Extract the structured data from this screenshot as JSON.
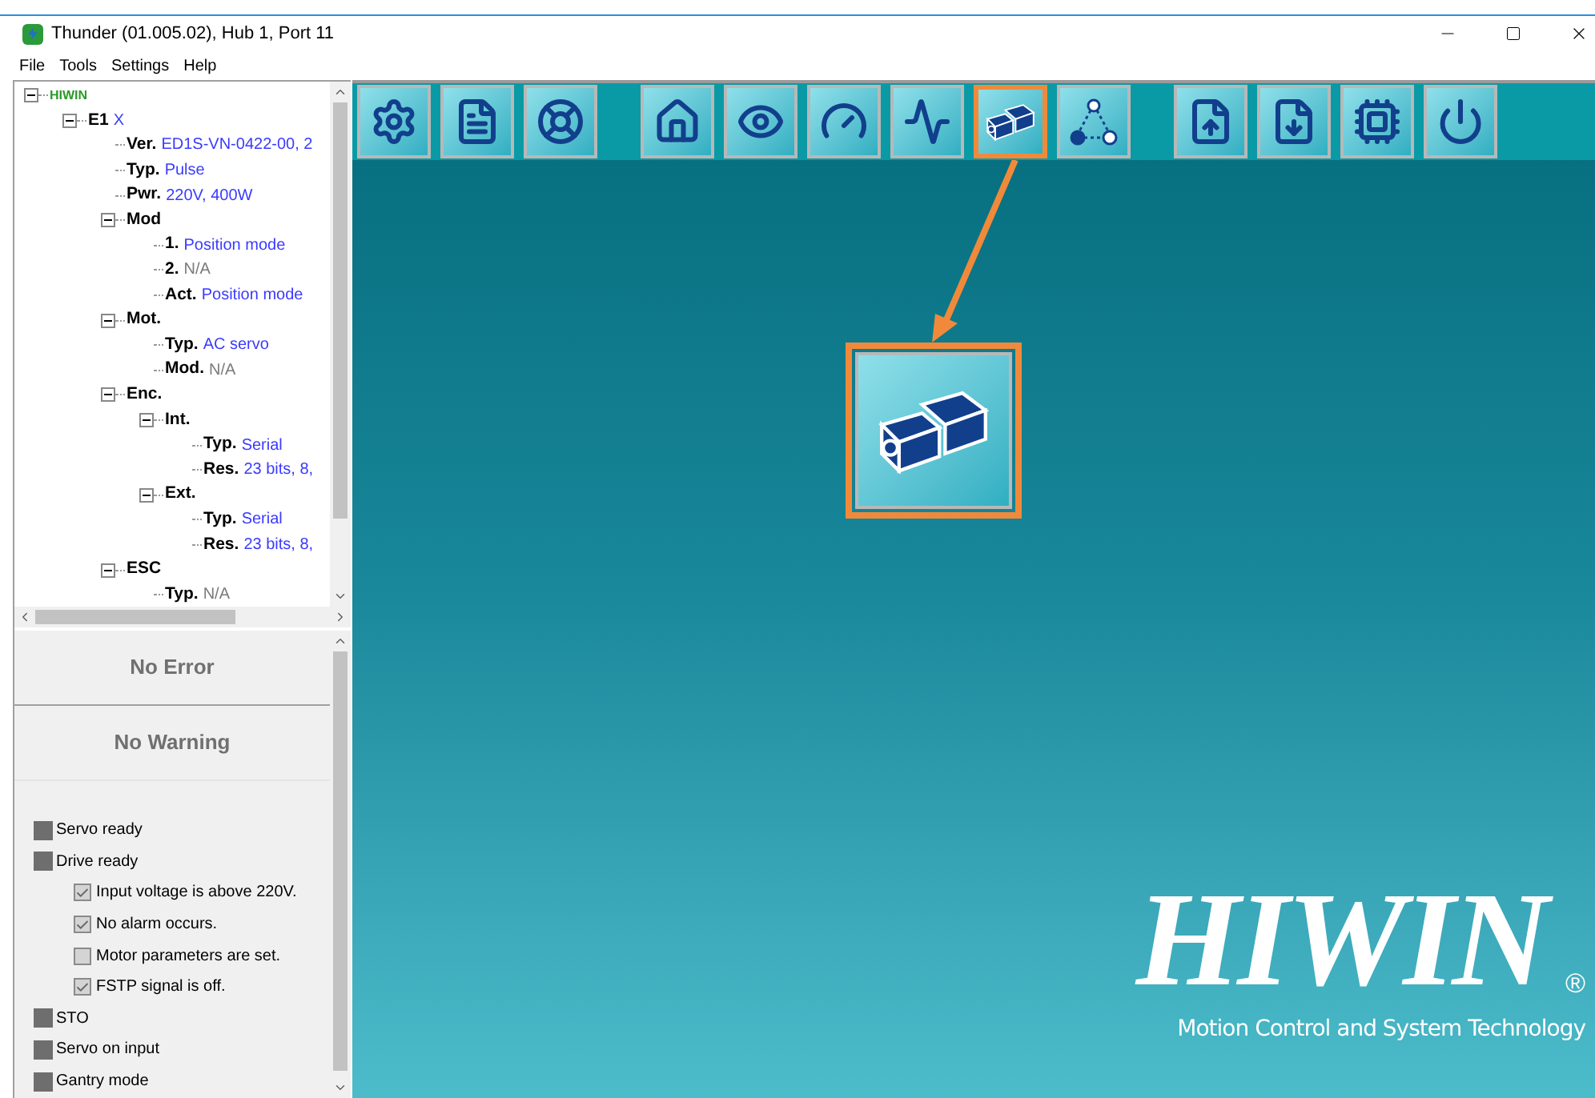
{
  "window": {
    "title": "Thunder (01.005.02), Hub 1, Port 11"
  },
  "menu": [
    "File",
    "Tools",
    "Settings",
    "Help"
  ],
  "tree": {
    "label": "HIWIN",
    "expanded": true,
    "children": [
      {
        "label": "E1",
        "value": "X",
        "expanded": true,
        "children": [
          {
            "label": "Ver.",
            "value": "ED1S-VN-0422-00, 2",
            "muted": false
          },
          {
            "label": "Typ.",
            "value": "Pulse",
            "muted": false
          },
          {
            "label": "Pwr.",
            "value": "220V, 400W",
            "muted": false
          },
          {
            "label": "Mod",
            "expanded": true,
            "children": [
              {
                "label": "1.",
                "value": "Position mode",
                "muted": false
              },
              {
                "label": "2.",
                "value": "N/A",
                "muted": true
              },
              {
                "label": "Act.",
                "value": "Position mode",
                "muted": false
              }
            ]
          },
          {
            "label": "Mot.",
            "expanded": true,
            "children": [
              {
                "label": "Typ.",
                "value": "AC servo",
                "muted": false
              },
              {
                "label": "Mod.",
                "value": "N/A",
                "muted": true
              }
            ]
          },
          {
            "label": "Enc.",
            "expanded": true,
            "children": [
              {
                "label": "Int.",
                "expanded": true,
                "children": [
                  {
                    "label": "Typ.",
                    "value": "Serial",
                    "muted": false
                  },
                  {
                    "label": "Res.",
                    "value": "23 bits, 8,",
                    "muted": false
                  }
                ]
              },
              {
                "label": "Ext.",
                "expanded": true,
                "children": [
                  {
                    "label": "Typ.",
                    "value": "Serial",
                    "muted": false
                  },
                  {
                    "label": "Res.",
                    "value": "23 bits, 8,",
                    "muted": false
                  }
                ]
              }
            ]
          },
          {
            "label": "ESC",
            "expanded": true,
            "children": [
              {
                "label": "Typ.",
                "value": "N/A",
                "muted": true
              }
            ]
          }
        ]
      }
    ]
  },
  "error_panel": "No Error",
  "warning_panel": "No Warning",
  "status": [
    {
      "kind": "indicator",
      "label": "Servo ready",
      "on": false
    },
    {
      "kind": "indicator",
      "label": "Drive ready",
      "on": false
    },
    {
      "kind": "check",
      "label": "Input voltage is above 220V.",
      "checked": true
    },
    {
      "kind": "check",
      "label": "No alarm occurs.",
      "checked": true
    },
    {
      "kind": "check",
      "label": "Motor parameters are set.",
      "checked": false
    },
    {
      "kind": "check",
      "label": "FSTP signal is off.",
      "checked": true
    },
    {
      "kind": "indicator",
      "label": "STO",
      "on": false
    },
    {
      "kind": "indicator",
      "label": "Servo on input",
      "on": false
    },
    {
      "kind": "indicator",
      "label": "Gantry mode",
      "on": false
    }
  ],
  "toolbar": [
    [
      {
        "kind": "gear-wrench",
        "selected": false
      },
      {
        "kind": "document",
        "selected": false
      },
      {
        "kind": "wheel",
        "selected": false
      }
    ],
    [
      {
        "kind": "house",
        "selected": false
      },
      {
        "kind": "eye",
        "selected": false
      },
      {
        "kind": "gauge",
        "selected": false
      },
      {
        "kind": "wave",
        "selected": false
      },
      {
        "kind": "motors",
        "selected": true
      },
      {
        "kind": "nodes",
        "selected": false
      }
    ],
    [
      {
        "kind": "doc-up",
        "selected": false
      },
      {
        "kind": "doc-down",
        "selected": false
      },
      {
        "kind": "chip",
        "selected": false
      },
      {
        "kind": "power",
        "selected": false
      }
    ]
  ],
  "callout": {
    "kind": "motors"
  },
  "logo": {
    "name": "HIWIN",
    "mark": "®",
    "tagline": "Motion Control and System Technology"
  }
}
